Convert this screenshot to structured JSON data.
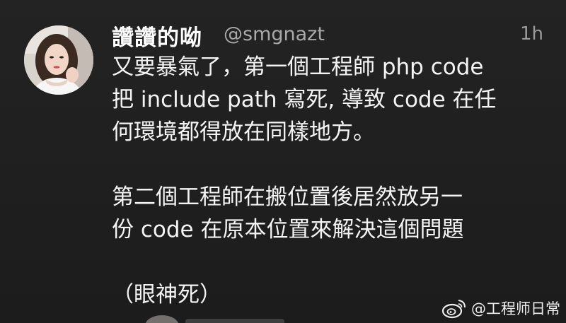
{
  "tweet": {
    "display_name": "讚讚的呦",
    "handle": "@smgnazt",
    "timestamp": "1h",
    "body_lines": [
      "又要暴氣了，第一個工程師 php code",
      "把 include path 寫死, 導致 code 在任",
      "何環境都得放在同樣地方。",
      "",
      "第二個工程師在搬位置後居然放另一",
      "份 code 在原本位置來解決這個問題",
      "",
      "（眼神死）"
    ]
  },
  "watermark": {
    "text": "@工程师日常",
    "icon": "weibo-logo-icon"
  },
  "colors": {
    "background": "#1f1f1f",
    "text": "#f4f4f4",
    "secondary_text": "#a9a9a9"
  }
}
